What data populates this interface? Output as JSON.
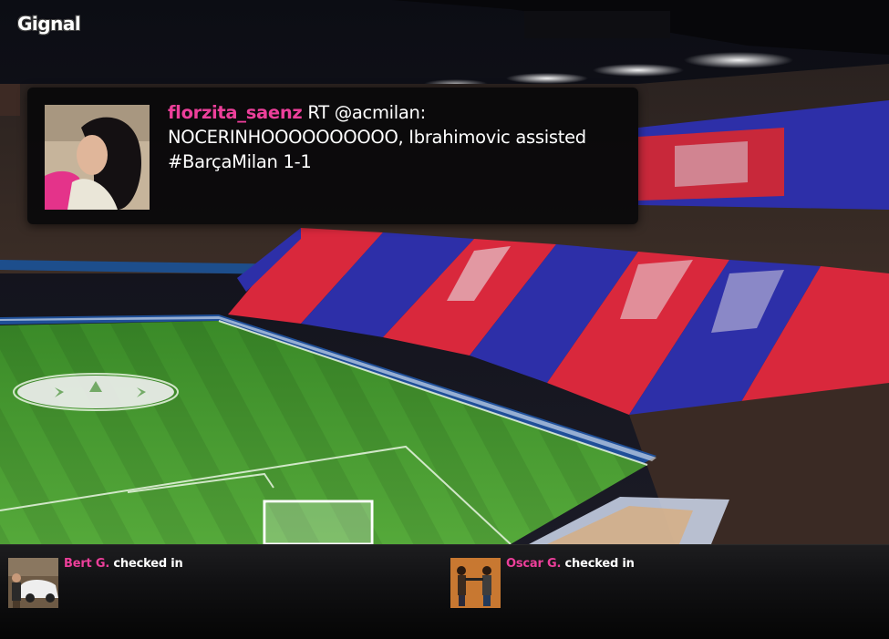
{
  "app": {
    "logo_text": "Gignal"
  },
  "tweet": {
    "username": "florzita_saenz",
    "text_line1": " RT @acmilan:",
    "text_line2": "NOCERINHOOOOOOOOOO, Ibrahimovic assisted",
    "text_line3": "#BarçaMilan 1-1"
  },
  "checkins": [
    {
      "name": "Bert G.",
      "action": "checked in"
    },
    {
      "name": "Oscar G.",
      "action": "checked in"
    }
  ],
  "colors": {
    "accent": "#ec3f9a",
    "card_bg": "#060608",
    "pitch": "#3d8a2a",
    "crowd_red": "#d9283c",
    "crowd_blue": "#2d2fa8"
  }
}
